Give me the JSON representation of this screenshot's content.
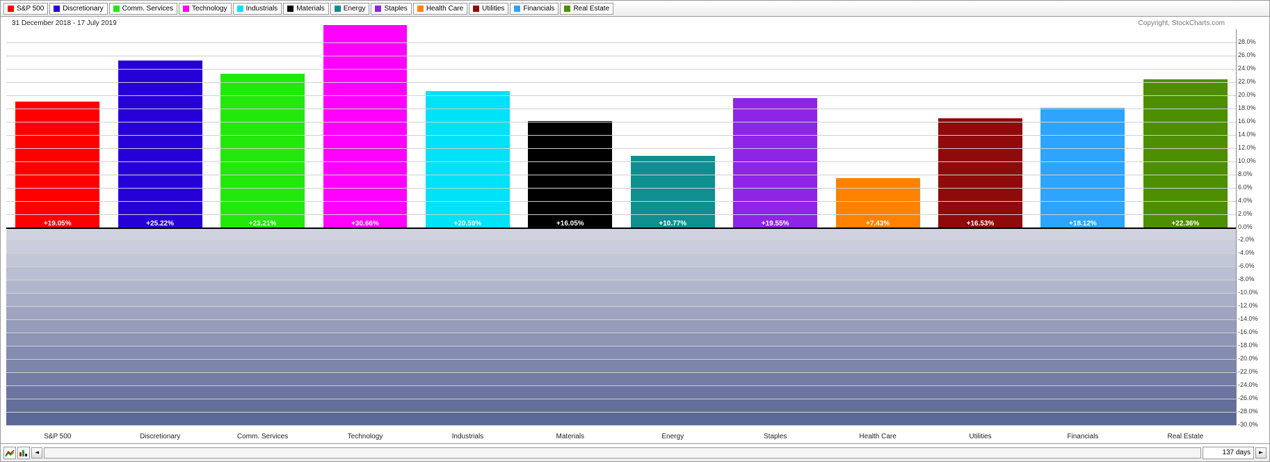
{
  "chart_data": {
    "type": "bar",
    "date_range": "31 December 2018 - 17 July 2019",
    "copyright": "Copyright, StockCharts.com",
    "ylim": [
      -30.0,
      30.0
    ],
    "y_ticks": [
      28.0,
      26.0,
      24.0,
      22.0,
      20.0,
      18.0,
      16.0,
      14.0,
      12.0,
      10.0,
      8.0,
      6.0,
      4.0,
      2.0,
      0.0,
      -2.0,
      -4.0,
      -6.0,
      -8.0,
      -10.0,
      -12.0,
      -14.0,
      -16.0,
      -18.0,
      -20.0,
      -22.0,
      -24.0,
      -26.0,
      -28.0,
      -30.0
    ],
    "ylabel": "",
    "xlabel": "",
    "categories": [
      "S&P 500",
      "Discretionary",
      "Comm. Services",
      "Technology",
      "Industrials",
      "Materials",
      "Energy",
      "Staples",
      "Health Care",
      "Utilities",
      "Financials",
      "Real Estate"
    ],
    "values": [
      19.05,
      25.22,
      23.21,
      30.66,
      20.59,
      16.05,
      10.77,
      19.55,
      7.43,
      16.53,
      18.12,
      22.36
    ],
    "value_labels": [
      "+19.05%",
      "+25.22%",
      "+23.21%",
      "+30.66%",
      "+20.59%",
      "+16.05%",
      "+10.77%",
      "+19.55%",
      "+7.43%",
      "+16.53%",
      "+18.12%",
      "+22.36%"
    ],
    "colors": [
      "#ff0000",
      "#2700d8",
      "#22e80c",
      "#ff00ff",
      "#00e2f7",
      "#000000",
      "#0f8f8f",
      "#8e24e6",
      "#ff8200",
      "#8f0a0a",
      "#2da5ff",
      "#4d8f00"
    ],
    "neg_band_colors": [
      "#d0d2df",
      "#cacddb",
      "#c2c6d7",
      "#babed1",
      "#b1b6cc",
      "#a8aec6",
      "#9fa5c0",
      "#969dba",
      "#8d95b5",
      "#848cb0",
      "#7c85aa",
      "#737da5",
      "#6b75a0",
      "#636e9b",
      "#5b6796"
    ]
  },
  "footer": {
    "days_label": "137 days"
  }
}
